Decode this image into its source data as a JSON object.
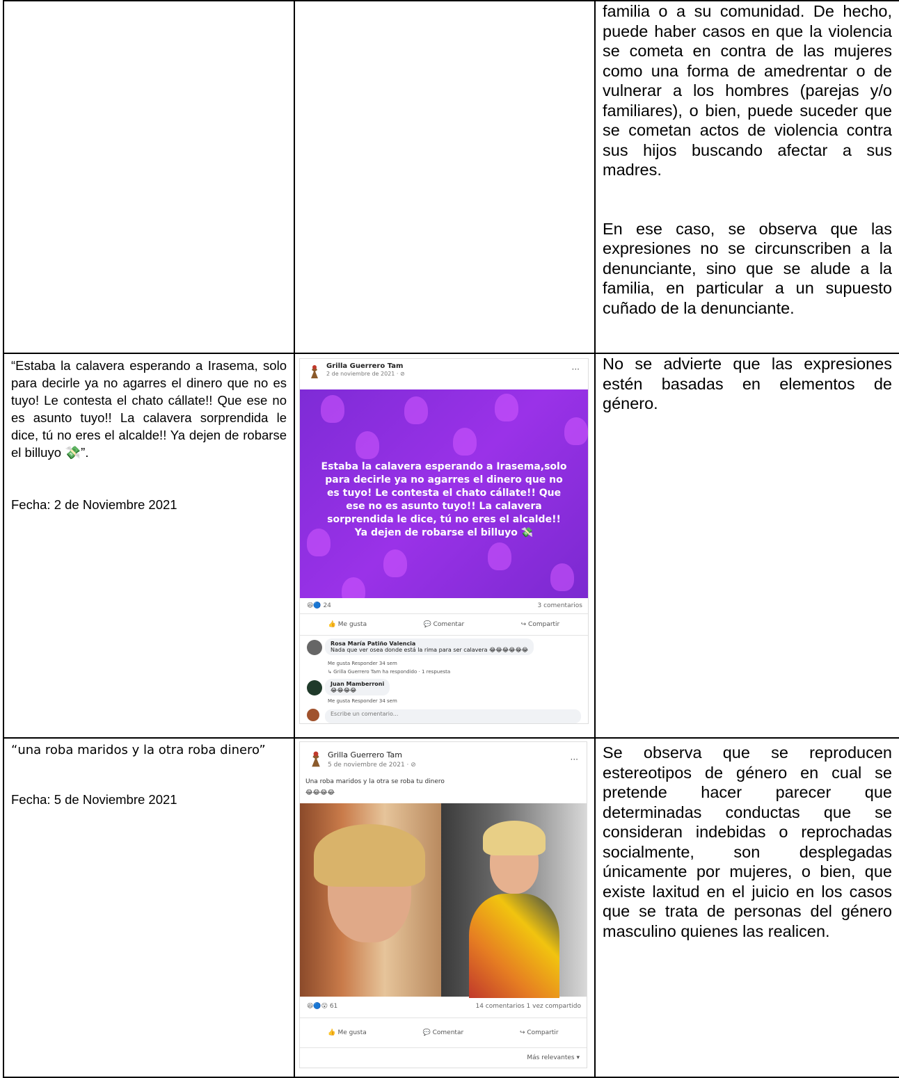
{
  "rows": [
    {
      "col1": "",
      "col3": [
        "familia o a su comunidad. De hecho, puede haber casos en que la violencia se cometa en contra de las mujeres como una forma de amedrentar o de vulnerar a los hombres (parejas y/o familiares), o bien, puede suceder que se cometan actos de violencia contra sus hijos buscando afectar a sus madres.",
        "En ese caso, se observa que las expresiones no se circunscriben a la denunciante, sino que se alude a la familia, en particular a un supuesto cuñado de la denunciante."
      ]
    },
    {
      "col1_quote": "“Estaba la calavera esperando a Irasema, solo para decirle ya no agarres el dinero que no es tuyo! Le contesta el chato cállate!! Que ese no es asunto tuyo!! La calavera sorprendida le dice, tú no eres el alcalde!! Ya dejen de robarse el billuyo 💸”.",
      "col1_date": "Fecha: 2 de Noviembre 2021",
      "col3": "No se advierte que las expresiones estén basadas en elementos de género.",
      "post": {
        "author": "Grilla Guerrero Tam",
        "date": "2 de noviembre de 2021 · ⊘",
        "text": "Estaba la calavera esperando a Irasema,solo para decirle ya no agarres el dinero que no es tuyo! Le contesta el chato cállate!! Que ese no es asunto tuyo!! La calavera sorprendida le dice, tú no eres el alcalde!! Ya dejen de robarse el billuyo 💸",
        "reactions": "😆🔵 24",
        "comments_count": "3 comentarios",
        "like": "👍 Me gusta",
        "comment": "💬 Comentar",
        "share": "↪ Compartir",
        "comment1_author": "Rosa María Patiño Valencia",
        "comment1_text": "Nada que ver osea donde está la rima para ser calavera 😂😂😂😂😂😂",
        "comment1_meta": "Me gusta   Responder   34 sem",
        "comment1_reply": "↳ Grilla Guerrero Tam ha respondido · 1 respuesta",
        "comment2_author": "Juan Mamberroni",
        "comment2_text": "😂😂😂😂",
        "comment2_meta": "Me gusta   Responder   34 sem",
        "write": "Escribe un comentario..."
      }
    },
    {
      "col1_quote": "“una roba maridos y la otra roba dinero”",
      "col1_date": "Fecha: 5 de Noviembre 2021",
      "col3": "Se observa que se reproducen estereotipos de género en cual se pretende hacer parecer que determinadas conductas que se consideran indebidas o reprochadas socialmente, son desplegadas únicamente por mujeres, o bien, que existe laxitud en el juicio en los casos que se trata de personas del género masculino quienes las realicen.",
      "post": {
        "author": "Grilla Guerrero Tam",
        "date": "5 de noviembre de 2021 · ⊘",
        "text": "Una roba maridos y la otra se roba tu dinero",
        "emojis": "😂😂😂😂",
        "reactions": "😆🔵😮 61",
        "stats": "14 comentarios  1 vez compartido",
        "like": "👍 Me gusta",
        "comment": "💬 Comentar",
        "share": "↪ Compartir",
        "relevant": "Más relevantes ▾"
      }
    }
  ]
}
